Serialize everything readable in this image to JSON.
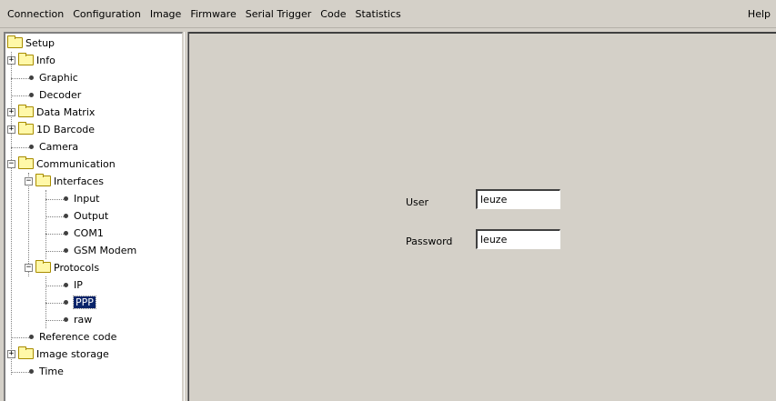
{
  "menu": {
    "items": [
      "Connection",
      "Configuration",
      "Image",
      "Firmware",
      "Serial Trigger",
      "Code",
      "Statistics"
    ],
    "help": "Help"
  },
  "tree": {
    "root": "Setup",
    "info": "Info",
    "graphic": "Graphic",
    "decoder": "Decoder",
    "data_matrix": "Data Matrix",
    "barcode_1d": "1D Barcode",
    "camera": "Camera",
    "communication": "Communication",
    "interfaces": "Interfaces",
    "input": "Input",
    "output": "Output",
    "com1": "COM1",
    "gsm_modem": "GSM Modem",
    "protocols": "Protocols",
    "ip": "IP",
    "ppp": "PPP",
    "raw": "raw",
    "reference_code": "Reference code",
    "image_storage": "Image storage",
    "time": "Time",
    "selected": "PPP"
  },
  "form": {
    "user_label": "User",
    "user_value": "leuze",
    "password_label": "Password",
    "password_value": "leuze"
  }
}
